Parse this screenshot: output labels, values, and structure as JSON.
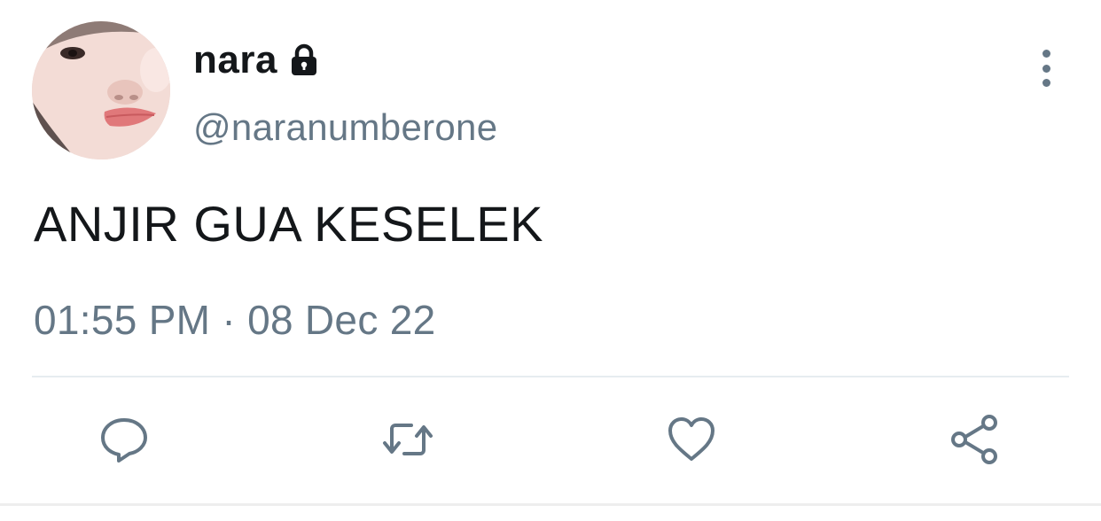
{
  "tweet": {
    "display_name": "nara",
    "handle": "@naranumberone",
    "protected_icon": "lock-icon",
    "text": "ANJIR GUA KESELEK",
    "timestamp": "01:55 PM · 08 Dec 22"
  },
  "actions": {
    "reply_icon": "reply-icon",
    "retweet_icon": "retweet-icon",
    "like_icon": "heart-icon",
    "share_icon": "share-icon",
    "more_icon": "more-vertical-icon"
  },
  "colors": {
    "primary_text": "#14171a",
    "secondary_text": "#657786",
    "divider": "#e6ecf0"
  }
}
